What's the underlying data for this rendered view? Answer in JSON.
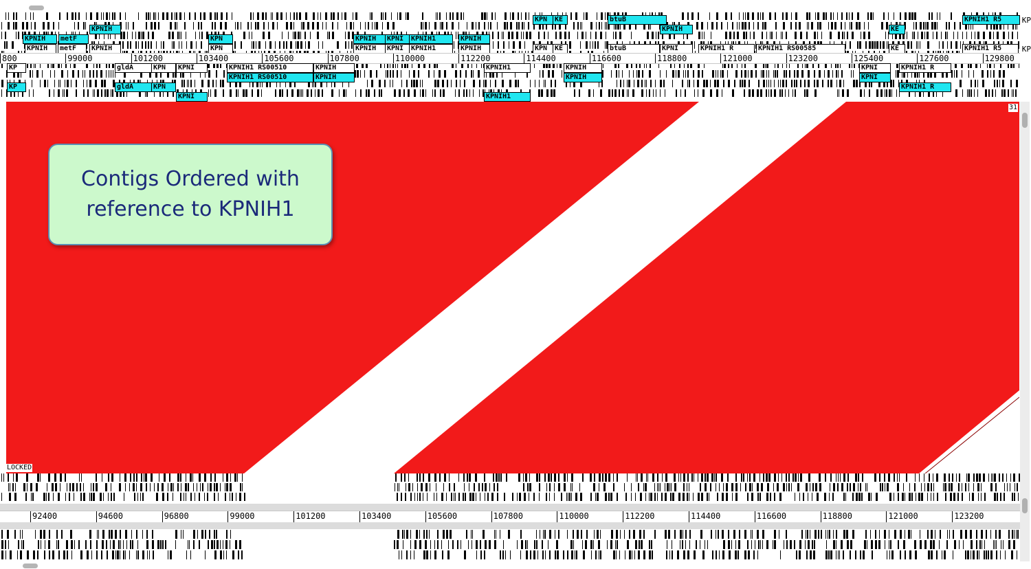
{
  "top_ruler": {
    "ticks": [
      "800",
      "99000",
      "101200",
      "103400",
      "105600",
      "107800",
      "110000",
      "112200",
      "114400",
      "116600",
      "118800",
      "121000",
      "123200",
      "125400",
      "127600",
      "129800"
    ]
  },
  "bottom_ruler": {
    "ticks": [
      "92400",
      "94600",
      "96800",
      "99000",
      "101200",
      "103400",
      "105600",
      "107800",
      "110000",
      "112200",
      "114400",
      "116600",
      "118800",
      "121000",
      "123200"
    ]
  },
  "top_genes": {
    "row1": [
      "KPN",
      "KE",
      "btuB",
      "KPNIH1 R5",
      "KE"
    ],
    "row2": [
      "KPNIH",
      "metF",
      "KPNIH",
      "KPN",
      "KPNIH",
      "KPNI",
      "KPNIH1",
      "KPNIH",
      "KPNIH1",
      "KE"
    ],
    "row3": [
      "KPNIH",
      "metF",
      "KPNIH",
      "KPN",
      "KPNIH",
      "KPNI",
      "KPNIH1",
      "KPNIH",
      "KPN",
      "KE",
      "btuB",
      "KPNI",
      "KPNIH1 R",
      "KPNIH1 RS00585",
      "KE",
      "KPNIH1 R5"
    ],
    "row5": [
      "KP",
      "gldA",
      "KPN",
      "KPNI",
      "KPNIH1 RS00510",
      "KPNIH",
      "KPNIH1",
      "KPNIH",
      "KPNI",
      "KPNIH1 R"
    ],
    "row6": [
      "KPNIH1 RS00510",
      "KPNIH",
      "KPNIH",
      "KPNI"
    ],
    "row7": [
      "KP",
      "gldA",
      "KPN",
      "KPNIH1",
      "KPNIH1 R"
    ],
    "row8": [
      "KPNI",
      "KPNIH1"
    ]
  },
  "right_label": "KP",
  "locked_label": "LOCKED",
  "corner_number": "31",
  "annotation": {
    "line1": "Contigs Ordered with",
    "line2": "reference to KPNIH1"
  },
  "colors": {
    "match": "#f21a1a",
    "gene_fill": "#20e6f0",
    "annotation_fill": "#ccf9cc",
    "annotation_text": "#1b2a7a"
  }
}
